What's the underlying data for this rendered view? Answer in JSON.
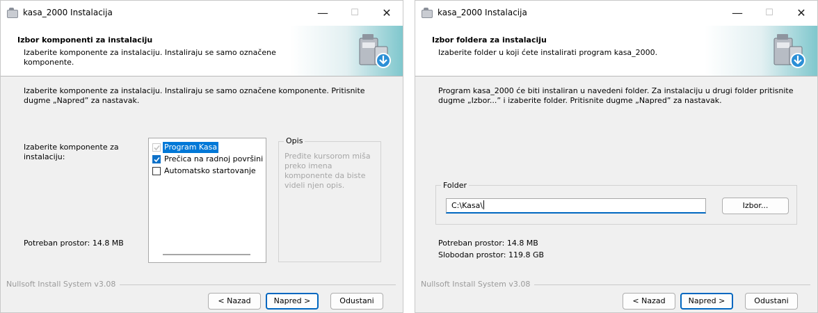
{
  "window1": {
    "title": "kasa_2000 Instalacija",
    "header_title": "Izbor komponenti za instalaciju",
    "header_subtitle": "Izaberite komponente za instalaciju. Instaliraju se samo označene komponente.",
    "instructions": "Izaberite komponente za instalaciju. Instaliraju se samo označene komponente. Pritisnite dugme „Napred” za nastavak.",
    "components_label": "Izaberite komponente za instalaciju:",
    "components": [
      {
        "label": "Program Kasa",
        "checked": true,
        "disabled": true,
        "selected": true
      },
      {
        "label": "Prečica na radnoj površini",
        "checked": true,
        "disabled": false,
        "selected": false
      },
      {
        "label": "Automatsko startovanje",
        "checked": false,
        "disabled": false,
        "selected": false
      }
    ],
    "description_title": "Opis",
    "description_text": "Pređite kursorom miša preko imena komponente da biste videli njen opis.",
    "required_space": "Potreban prostor: 14.8 MB",
    "footer_brand": "Nullsoft Install System v3.08",
    "buttons": {
      "back": "< Nazad",
      "next": "Napred >",
      "cancel": "Odustani"
    }
  },
  "window2": {
    "title": "kasa_2000 Instalacija",
    "header_title": "Izbor foldera za instalaciju",
    "header_subtitle": "Izaberite folder u koji ćete instalirati program kasa_2000.",
    "instructions": "Program kasa_2000 će biti instaliran u navedeni folder. Za instalaciju u drugi folder pritisnite dugme „Izbor...” i izaberite folder. Pritisnite dugme „Napred” za nastavak.",
    "folder_group_title": "Folder",
    "folder_value": "C:\\Kasa\\",
    "browse_button": "Izbor...",
    "required_space": "Potreban prostor: 14.8 MB",
    "free_space": "Slobodan prostor: 119.8 GB",
    "footer_brand": "Nullsoft Install System v3.08",
    "buttons": {
      "back": "< Nazad",
      "next": "Napred >",
      "cancel": "Odustani"
    }
  },
  "titlebar_icons": [
    "minimize-icon",
    "maximize-icon",
    "close-icon"
  ],
  "colors": {
    "accent": "#0067c0",
    "selection": "#0078d7",
    "header_gradient": "#7fc7cd"
  }
}
